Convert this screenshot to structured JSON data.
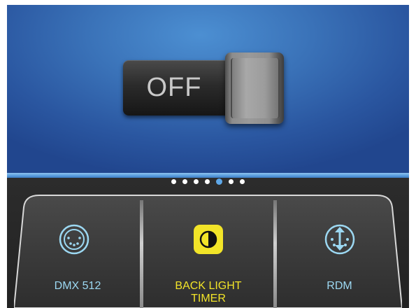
{
  "toggle": {
    "state_label": "OFF"
  },
  "pager": {
    "dot_count": 7,
    "active_index": 4
  },
  "menu": {
    "items": [
      {
        "label": "DMX 512",
        "icon": "dmx-connector-icon",
        "selected": false
      },
      {
        "label": "BACK LIGHT\nTIMER",
        "icon": "contrast-icon",
        "selected": true
      },
      {
        "label": "RDM",
        "icon": "rdm-connector-icon",
        "selected": false
      }
    ]
  },
  "colors": {
    "panel_blue": "#2f63aa",
    "accent_blue": "#5fa8e8",
    "label_cyan": "#9cd8f2",
    "selected_yellow": "#f2e428"
  }
}
